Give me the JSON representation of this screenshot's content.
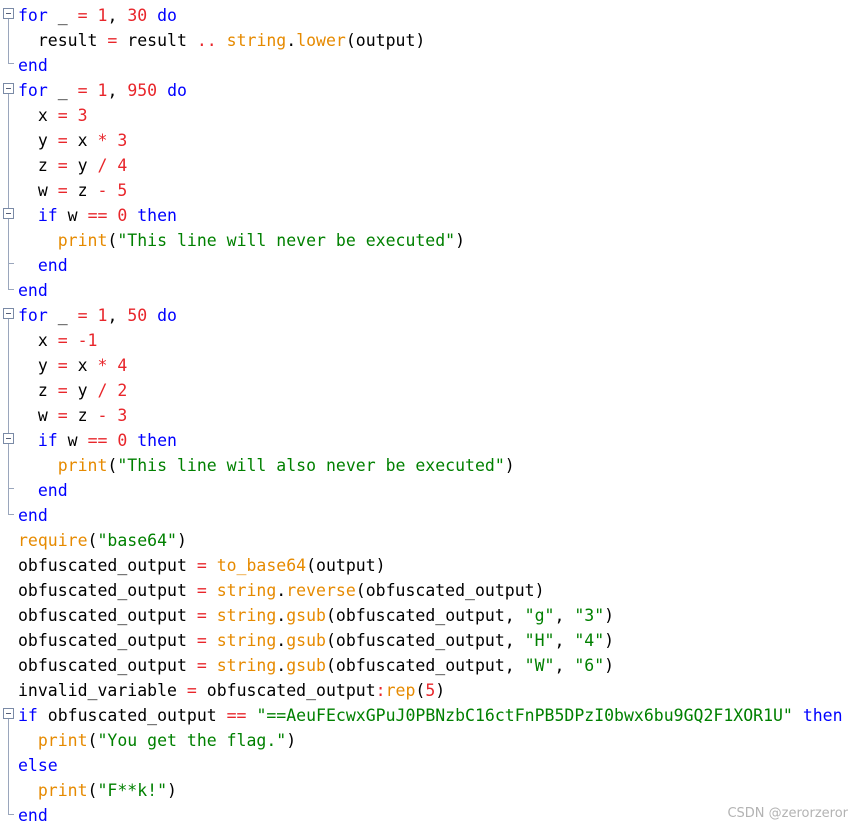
{
  "lines": [
    [
      [
        "kw",
        "for"
      ],
      [
        "t",
        " _ "
      ],
      [
        "op",
        "="
      ],
      [
        "t",
        " "
      ],
      [
        "num",
        "1"
      ],
      [
        "t",
        ", "
      ],
      [
        "num",
        "30"
      ],
      [
        "t",
        " "
      ],
      [
        "kw",
        "do"
      ]
    ],
    [
      [
        "t",
        "  result "
      ],
      [
        "op",
        "="
      ],
      [
        "t",
        " result "
      ],
      [
        "op",
        ".."
      ],
      [
        "t",
        " "
      ],
      [
        "fn",
        "string"
      ],
      [
        "t",
        "."
      ],
      [
        "fn",
        "lower"
      ],
      [
        "t",
        "(output)"
      ]
    ],
    [
      [
        "kw",
        "end"
      ]
    ],
    [
      [
        "kw",
        "for"
      ],
      [
        "t",
        " _ "
      ],
      [
        "op",
        "="
      ],
      [
        "t",
        " "
      ],
      [
        "num",
        "1"
      ],
      [
        "t",
        ", "
      ],
      [
        "num",
        "950"
      ],
      [
        "t",
        " "
      ],
      [
        "kw",
        "do"
      ]
    ],
    [
      [
        "t",
        "  x "
      ],
      [
        "op",
        "="
      ],
      [
        "t",
        " "
      ],
      [
        "num",
        "3"
      ]
    ],
    [
      [
        "t",
        "  y "
      ],
      [
        "op",
        "="
      ],
      [
        "t",
        " x "
      ],
      [
        "op",
        "*"
      ],
      [
        "t",
        " "
      ],
      [
        "num",
        "3"
      ]
    ],
    [
      [
        "t",
        "  z "
      ],
      [
        "op",
        "="
      ],
      [
        "t",
        " y "
      ],
      [
        "op",
        "/"
      ],
      [
        "t",
        " "
      ],
      [
        "num",
        "4"
      ]
    ],
    [
      [
        "t",
        "  w "
      ],
      [
        "op",
        "="
      ],
      [
        "t",
        " z "
      ],
      [
        "op",
        "-"
      ],
      [
        "t",
        " "
      ],
      [
        "num",
        "5"
      ]
    ],
    [
      [
        "t",
        "  "
      ],
      [
        "kw",
        "if"
      ],
      [
        "t",
        " w "
      ],
      [
        "op",
        "=="
      ],
      [
        "t",
        " "
      ],
      [
        "num",
        "0"
      ],
      [
        "t",
        " "
      ],
      [
        "kw",
        "then"
      ]
    ],
    [
      [
        "t",
        "    "
      ],
      [
        "fn",
        "print"
      ],
      [
        "t",
        "("
      ],
      [
        "str",
        "\"This line will never be executed\""
      ],
      [
        "t",
        ")"
      ]
    ],
    [
      [
        "t",
        "  "
      ],
      [
        "kw",
        "end"
      ]
    ],
    [
      [
        "kw",
        "end"
      ]
    ],
    [
      [
        "kw",
        "for"
      ],
      [
        "t",
        " _ "
      ],
      [
        "op",
        "="
      ],
      [
        "t",
        " "
      ],
      [
        "num",
        "1"
      ],
      [
        "t",
        ", "
      ],
      [
        "num",
        "50"
      ],
      [
        "t",
        " "
      ],
      [
        "kw",
        "do"
      ]
    ],
    [
      [
        "t",
        "  x "
      ],
      [
        "op",
        "="
      ],
      [
        "t",
        " "
      ],
      [
        "num",
        "-1"
      ]
    ],
    [
      [
        "t",
        "  y "
      ],
      [
        "op",
        "="
      ],
      [
        "t",
        " x "
      ],
      [
        "op",
        "*"
      ],
      [
        "t",
        " "
      ],
      [
        "num",
        "4"
      ]
    ],
    [
      [
        "t",
        "  z "
      ],
      [
        "op",
        "="
      ],
      [
        "t",
        " y "
      ],
      [
        "op",
        "/"
      ],
      [
        "t",
        " "
      ],
      [
        "num",
        "2"
      ]
    ],
    [
      [
        "t",
        "  w "
      ],
      [
        "op",
        "="
      ],
      [
        "t",
        " z "
      ],
      [
        "op",
        "-"
      ],
      [
        "t",
        " "
      ],
      [
        "num",
        "3"
      ]
    ],
    [
      [
        "t",
        "  "
      ],
      [
        "kw",
        "if"
      ],
      [
        "t",
        " w "
      ],
      [
        "op",
        "=="
      ],
      [
        "t",
        " "
      ],
      [
        "num",
        "0"
      ],
      [
        "t",
        " "
      ],
      [
        "kw",
        "then"
      ]
    ],
    [
      [
        "t",
        "    "
      ],
      [
        "fn",
        "print"
      ],
      [
        "t",
        "("
      ],
      [
        "str",
        "\"This line will also never be executed\""
      ],
      [
        "t",
        ")"
      ]
    ],
    [
      [
        "t",
        "  "
      ],
      [
        "kw",
        "end"
      ]
    ],
    [
      [
        "kw",
        "end"
      ]
    ],
    [
      [
        "fn",
        "require"
      ],
      [
        "t",
        "("
      ],
      [
        "str",
        "\"base64\""
      ],
      [
        "t",
        ")"
      ]
    ],
    [
      [
        "t",
        "obfuscated_output "
      ],
      [
        "op",
        "="
      ],
      [
        "t",
        " "
      ],
      [
        "fn",
        "to_base64"
      ],
      [
        "t",
        "(output)"
      ]
    ],
    [
      [
        "t",
        "obfuscated_output "
      ],
      [
        "op",
        "="
      ],
      [
        "t",
        " "
      ],
      [
        "fn",
        "string"
      ],
      [
        "t",
        "."
      ],
      [
        "fn",
        "reverse"
      ],
      [
        "t",
        "(obfuscated_output)"
      ]
    ],
    [
      [
        "t",
        "obfuscated_output "
      ],
      [
        "op",
        "="
      ],
      [
        "t",
        " "
      ],
      [
        "fn",
        "string"
      ],
      [
        "t",
        "."
      ],
      [
        "fn",
        "gsub"
      ],
      [
        "t",
        "(obfuscated_output, "
      ],
      [
        "str",
        "\"g\""
      ],
      [
        "t",
        ", "
      ],
      [
        "str",
        "\"3\""
      ],
      [
        "t",
        ")"
      ]
    ],
    [
      [
        "t",
        "obfuscated_output "
      ],
      [
        "op",
        "="
      ],
      [
        "t",
        " "
      ],
      [
        "fn",
        "string"
      ],
      [
        "t",
        "."
      ],
      [
        "fn",
        "gsub"
      ],
      [
        "t",
        "(obfuscated_output, "
      ],
      [
        "str",
        "\"H\""
      ],
      [
        "t",
        ", "
      ],
      [
        "str",
        "\"4\""
      ],
      [
        "t",
        ")"
      ]
    ],
    [
      [
        "t",
        "obfuscated_output "
      ],
      [
        "op",
        "="
      ],
      [
        "t",
        " "
      ],
      [
        "fn",
        "string"
      ],
      [
        "t",
        "."
      ],
      [
        "fn",
        "gsub"
      ],
      [
        "t",
        "(obfuscated_output, "
      ],
      [
        "str",
        "\"W\""
      ],
      [
        "t",
        ", "
      ],
      [
        "str",
        "\"6\""
      ],
      [
        "t",
        ")"
      ]
    ],
    [
      [
        "t",
        "invalid_variable "
      ],
      [
        "op",
        "="
      ],
      [
        "t",
        " obfuscated_output"
      ],
      [
        "op",
        ":"
      ],
      [
        "fn",
        "rep"
      ],
      [
        "t",
        "("
      ],
      [
        "num",
        "5"
      ],
      [
        "t",
        ")"
      ]
    ],
    [
      [
        "kw",
        "if"
      ],
      [
        "t",
        " obfuscated_output "
      ],
      [
        "op",
        "=="
      ],
      [
        "t",
        " "
      ],
      [
        "str",
        "\"==AeuFEcwxGPuJ0PBNzbC16ctFnPB5DPzI0bwx6bu9GQ2F1XOR1U\""
      ],
      [
        "t",
        " "
      ],
      [
        "kw",
        "then"
      ]
    ],
    [
      [
        "t",
        "  "
      ],
      [
        "fn",
        "print"
      ],
      [
        "t",
        "("
      ],
      [
        "str",
        "\"You get the flag.\""
      ],
      [
        "t",
        ")"
      ]
    ],
    [
      [
        "kw",
        "else"
      ]
    ],
    [
      [
        "t",
        "  "
      ],
      [
        "fn",
        "print"
      ],
      [
        "t",
        "("
      ],
      [
        "str",
        "\"F**k!\""
      ],
      [
        "t",
        ")"
      ]
    ],
    [
      [
        "kw",
        "end"
      ]
    ]
  ],
  "watermark": "CSDN @zerorzeror",
  "colors": {
    "keyword": "#0000ff",
    "number": "#e8262b",
    "operator": "#e8262b",
    "function": "#e68a00",
    "string": "#008000",
    "text": "#000000",
    "fold_marker": "#7a8aa6"
  },
  "fold_markers": [
    {
      "type": "minus-box",
      "line": 1
    },
    {
      "type": "end",
      "line": 3
    },
    {
      "type": "minus-box",
      "line": 4
    },
    {
      "type": "minus-box",
      "line": 9
    },
    {
      "type": "end",
      "line": 11
    },
    {
      "type": "end",
      "line": 12
    },
    {
      "type": "minus-box",
      "line": 13
    },
    {
      "type": "minus-box",
      "line": 18
    },
    {
      "type": "end",
      "line": 20
    },
    {
      "type": "end",
      "line": 21
    },
    {
      "type": "minus-box",
      "line": 29
    },
    {
      "type": "end",
      "line": 33
    }
  ]
}
